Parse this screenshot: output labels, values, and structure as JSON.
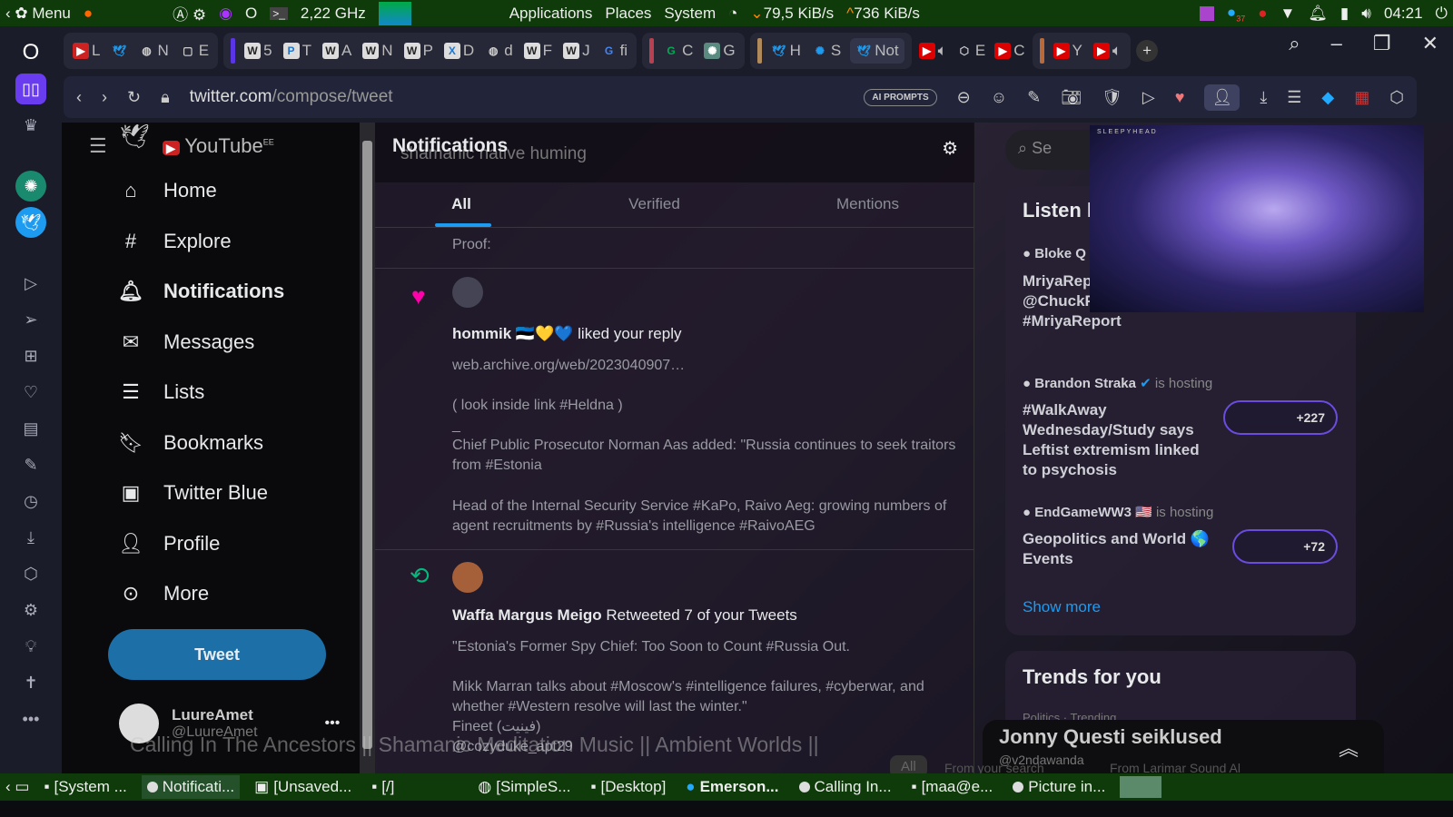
{
  "panel": {
    "menu": "Menu",
    "cpu": "2,22 GHz",
    "applications": "Applications",
    "places": "Places",
    "system": "System",
    "net_down": "79,5 KiB/s",
    "net_up": "736 KiB/s",
    "clock": "04:21",
    "badge_count": "37"
  },
  "tabs": [
    {
      "icon": "youtube",
      "label": "L"
    },
    {
      "icon": "twitter",
      "label": ""
    },
    {
      "icon": "globe",
      "label": "N"
    },
    {
      "icon": "tab",
      "label": "E"
    },
    {
      "icon": "W",
      "label": "5"
    },
    {
      "icon": "P",
      "label": "T"
    },
    {
      "icon": "W",
      "label": "A"
    },
    {
      "icon": "W",
      "label": "N"
    },
    {
      "icon": "W",
      "label": "P"
    },
    {
      "icon": "X",
      "label": "D"
    },
    {
      "icon": "globe",
      "label": "d"
    },
    {
      "icon": "W",
      "label": "F"
    },
    {
      "icon": "W",
      "label": "J"
    },
    {
      "icon": "G",
      "label": "fi"
    },
    {
      "icon": "G",
      "label": "C"
    },
    {
      "icon": "chatgpt",
      "label": "G"
    },
    {
      "icon": "twitter",
      "label": "H"
    },
    {
      "icon": "openai",
      "label": "S"
    },
    {
      "icon": "twitter",
      "label": "Not"
    },
    {
      "icon": "youtube",
      "label": ""
    },
    {
      "icon": "cube",
      "label": "E"
    },
    {
      "icon": "youtube",
      "label": "C"
    },
    {
      "icon": "youtube",
      "label": "Y"
    },
    {
      "icon": "youtube",
      "label": ""
    }
  ],
  "addressbar": {
    "url_main": "twitter.com",
    "url_path": "/compose/tweet",
    "ai_prompts": "AI PROMPTS"
  },
  "twitter": {
    "nav": [
      "Home",
      "Explore",
      "Notifications",
      "Messages",
      "Lists",
      "Bookmarks",
      "Twitter Blue",
      "Profile",
      "More"
    ],
    "tweet_button": "Tweet",
    "account_name": "LuureAmet",
    "account_handle": "@LuureAmet",
    "youtube_logo": "YouTube",
    "youtube_region": "EE",
    "header_title": "Notifications",
    "ghost_search": "shamanic native huming",
    "tabs": [
      "All",
      "Verified",
      "Mentions"
    ],
    "proof": "Proof:",
    "n1": {
      "user": "hommik",
      "action": "liked your reply",
      "lines": [
        "web.archive.org/web/2023040907…",
        "( look inside link #Heldna )",
        "_",
        "Chief Public Prosecutor Norman Aas added: \"Russia continues to seek traitors from #Estonia",
        "Head of the Internal Security Service #KaPo,  Raivo Aeg: growing numbers of agent recruitments by #Russia's intelligence #RaivoAEG"
      ]
    },
    "n2": {
      "user": "Waffa Margus Meigo",
      "action": "Retweeted 7 of your Tweets",
      "lines": [
        "\"Estonia's Former Spy Chief: Too Soon to Count #Russia Out.",
        "Mikk Marran talks about #Moscow's #intelligence failures, #cyberwar, and whether #Western resolve will last the winter.\"",
        "Fineet (فينيت)",
        "@cozyduke_apt29"
      ]
    },
    "overlay_title": "Calling In The Ancestors || Shamanic Meditation Music || Ambient Worlds ||",
    "spaces": {
      "title": "Listen l",
      "items": [
        {
          "host": "Bloke Q",
          "status": "",
          "title": "MriyaRep Points wi @ChuckPfarrer ⛑ Help #MriyaReport",
          "count": ""
        },
        {
          "host": "Brandon Straka",
          "status": "is hosting",
          "title": "#WalkAway Wednesday/Study says Leftist extremism linked to psychosis",
          "count": "+227"
        },
        {
          "host": "EndGameWW3",
          "status": "is hosting",
          "title": "Geopolitics and World 🌎 Events",
          "count": "+72"
        }
      ],
      "show_more": "Show more"
    },
    "trends_title": "Trends for you",
    "trends_sub": "Politics · Trending",
    "search_ghost": "Se"
  },
  "pip": {
    "label": "SLEEPYHEAD"
  },
  "youtube_mini": {
    "title": "Jonny Questi seiklused",
    "handle": "@v2ndawanda",
    "chips": [
      "All",
      "From your search",
      "From Larimar Sound Al"
    ]
  },
  "taskbar": [
    "[System ...",
    "Notificati...",
    "[Unsaved...",
    "[/]",
    "[SimpleS...",
    "[Desktop]",
    "Emerson...",
    "Calling In...",
    "[maa@e...",
    "Picture in..."
  ]
}
